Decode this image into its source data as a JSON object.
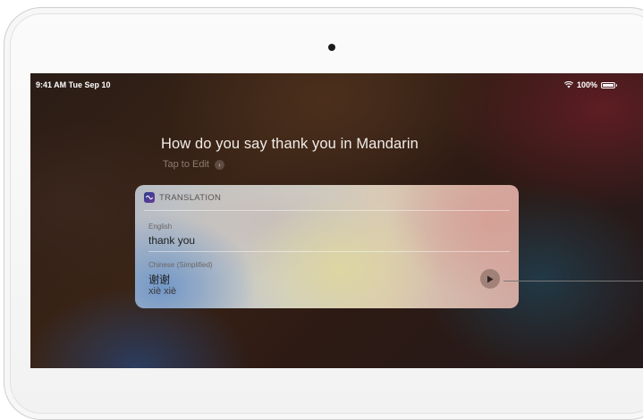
{
  "status_bar": {
    "time_date": "9:41 AM  Tue Sep 10",
    "battery": "100%",
    "battery_level": 1.0
  },
  "siri": {
    "query": "How do you say thank you in Mandarin",
    "tap_to_edit": "Tap to Edit",
    "chevron": "›"
  },
  "translation_card": {
    "header": "TRANSLATION",
    "source_language": "English",
    "source_text": "thank you",
    "target_language": "Chinese (Simplified)",
    "target_text": "谢谢",
    "pinyin": "xiè xiè",
    "play_icon": "play-icon"
  }
}
